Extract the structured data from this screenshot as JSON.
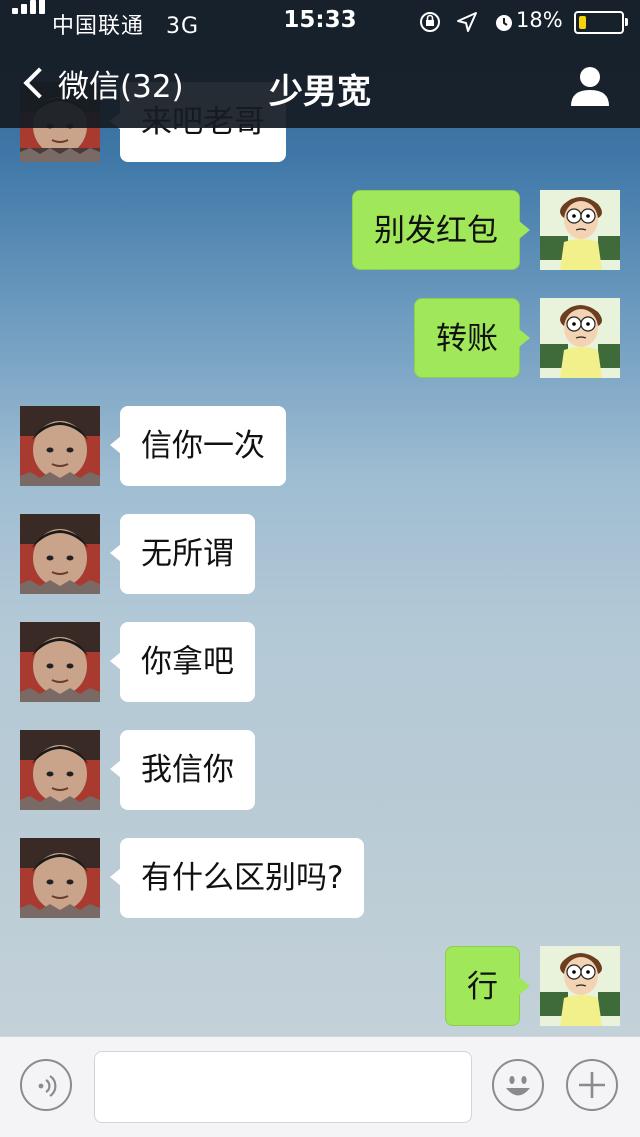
{
  "status_bar": {
    "carrier": "中国联通",
    "network": "3G",
    "time": "15:33",
    "battery_percent": "18%",
    "battery_level": 0.18,
    "battery_color": "#f5d50a"
  },
  "nav": {
    "back_label": "微信(32)",
    "title": "少男宽"
  },
  "messages": [
    {
      "side": "left",
      "text": "来吧老哥"
    },
    {
      "side": "right",
      "text": "别发红包"
    },
    {
      "side": "right",
      "text": "转账"
    },
    {
      "side": "left",
      "text": "信你一次"
    },
    {
      "side": "left",
      "text": "无所谓"
    },
    {
      "side": "left",
      "text": "你拿吧"
    },
    {
      "side": "left",
      "text": "我信你"
    },
    {
      "side": "left",
      "text": "有什么区别吗?"
    },
    {
      "side": "right",
      "text": "行"
    }
  ],
  "input_bar": {
    "voice_icon": "voice-icon",
    "emoji_icon": "emoji-icon",
    "add_icon": "plus-icon",
    "input_value": ""
  },
  "colors": {
    "sent_bubble": "#a0e75a",
    "received_bubble": "#ffffff",
    "nav_bg": "#161c24"
  }
}
